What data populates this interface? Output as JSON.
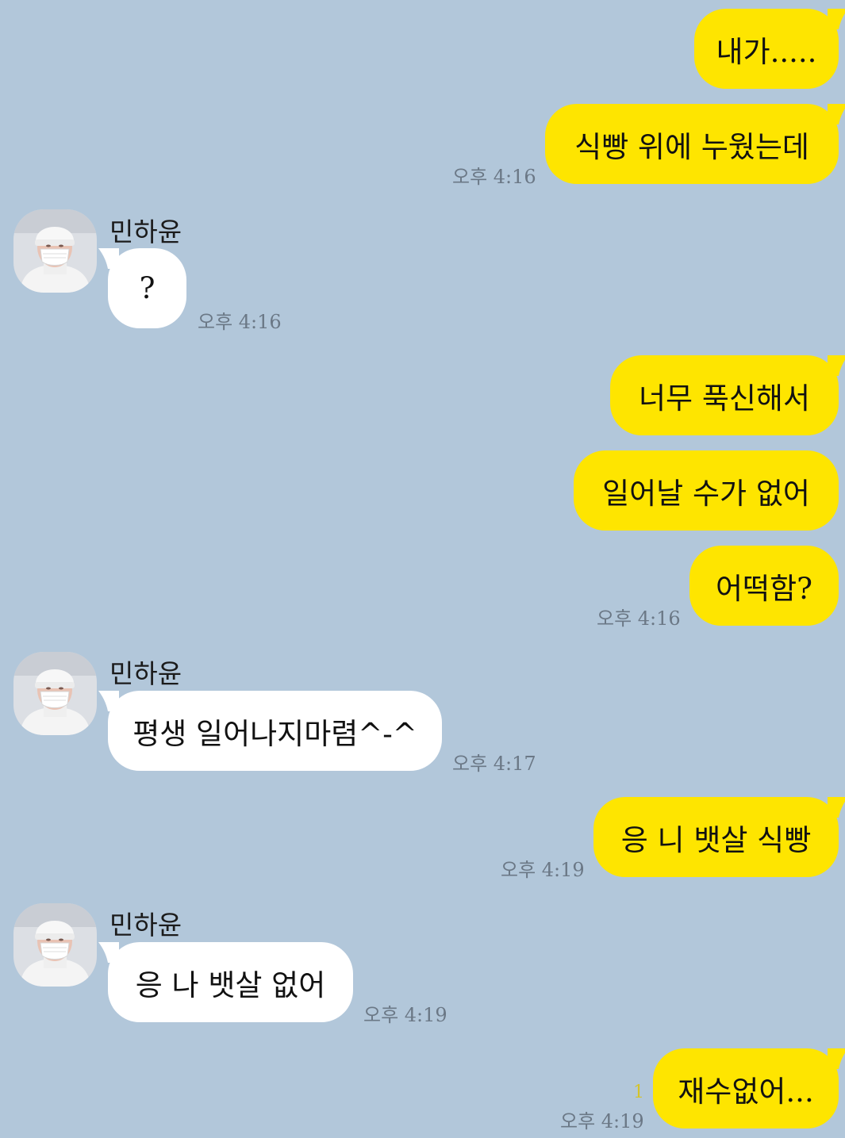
{
  "contact_name": "민하윤",
  "messages": [
    {
      "text": "내가....."
    },
    {
      "text": "식빵 위에 누웠는데",
      "time": "오후 4:16"
    },
    {
      "text": "?",
      "time": "오후 4:16"
    },
    {
      "text": "너무 푹신해서"
    },
    {
      "text": "일어날 수가 없어"
    },
    {
      "text": "어떡함?",
      "time": "오후 4:16"
    },
    {
      "text": "평생 일어나지마렴^-^",
      "time": "오후 4:17"
    },
    {
      "text": "응 니 뱃살 식빵",
      "time": "오후 4:19"
    },
    {
      "text": "응 나 뱃살 없어",
      "time": "오후 4:19"
    },
    {
      "text": "재수없어...",
      "time": "오후 4:19",
      "unread": "1"
    }
  ],
  "colors": {
    "background": "#b2c7da",
    "my_bubble": "#fee500",
    "their_bubble": "#ffffff",
    "timestamp": "#6b7886",
    "unread_count": "#d4c32a"
  }
}
